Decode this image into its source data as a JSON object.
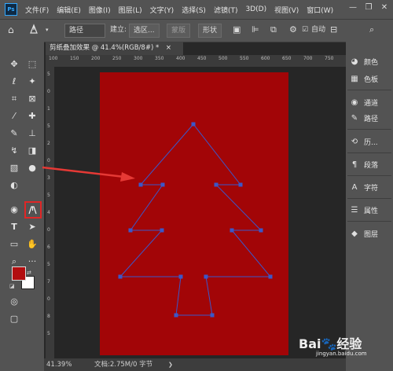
{
  "app": {
    "logo_text": "Ps"
  },
  "menu": [
    "文件(F)",
    "编辑(E)",
    "图像(I)",
    "图层(L)",
    "文字(Y)",
    "选择(S)",
    "滤镜(T)",
    "3D(D)",
    "视图(V)",
    "窗口(W)"
  ],
  "window_controls": {
    "minimize": "—",
    "restore": "❐",
    "close": "✕"
  },
  "options": {
    "tool_mode": "路径",
    "build_label": "建立:",
    "selection_button": "选区...",
    "mask_button": "蒙版",
    "shape_button": "形状",
    "auto_add_delete": "自动"
  },
  "document_tab": {
    "title": "剪纸叠加效果 @ 41.4%(RGB/8#) *",
    "close": "×"
  },
  "ruler_labels": {
    "top": [
      "100",
      "150",
      "200",
      "250",
      "300",
      "350",
      "400",
      "450",
      "500",
      "550",
      "600",
      "650",
      "700",
      "750"
    ],
    "left": [
      "5",
      "0",
      "1",
      "5",
      "2",
      "0",
      "3",
      "5",
      "4",
      "0",
      "6",
      "5",
      "7",
      "0",
      "8",
      "5"
    ]
  },
  "status": {
    "zoom": "41.39%",
    "doc_info": "文档:2.75M/0 字节"
  },
  "panels": [
    {
      "icon": "color-palette-icon",
      "glyph": "◕",
      "label": "颜色"
    },
    {
      "icon": "swatches-icon",
      "glyph": "▦",
      "label": "色板"
    },
    {
      "icon": "channels-icon",
      "glyph": "◉",
      "label": "通道"
    },
    {
      "icon": "paths-icon",
      "glyph": "✎",
      "label": "路径"
    },
    {
      "icon": "history-icon",
      "glyph": "⟲",
      "label": "历..."
    },
    {
      "icon": "paragraph-icon",
      "glyph": "¶",
      "label": "段落"
    },
    {
      "icon": "character-icon",
      "glyph": "A",
      "label": "字符"
    },
    {
      "icon": "properties-icon",
      "glyph": "☰",
      "label": "属性"
    },
    {
      "icon": "layers-icon",
      "glyph": "◆",
      "label": "图层"
    }
  ],
  "colors": {
    "foreground": "#b20e10",
    "background": "#ffffff",
    "canvas": "#a20507",
    "path": "#3b57c9",
    "arrow": "#e53935"
  },
  "watermark": {
    "brand": "Bai",
    "paw": "🐾",
    "suffix": "经验",
    "sub": "jingyan.baidu.com"
  }
}
